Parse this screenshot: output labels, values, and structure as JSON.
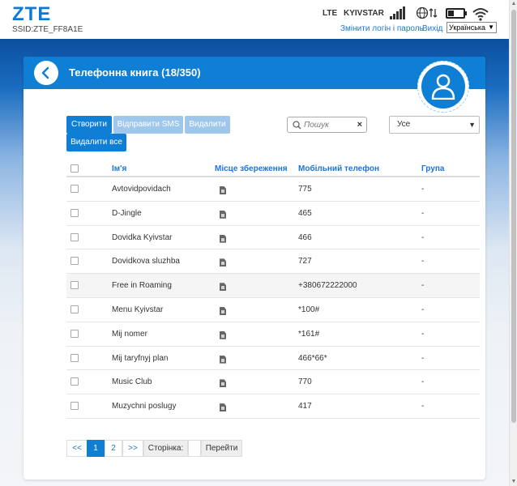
{
  "header": {
    "logo": "ZTE",
    "ssid": "SSID:ZTE_FF8A1E",
    "network_type": "LTE",
    "operator": "KYIVSTAR",
    "change_login_link": "Змінити логін і пароль",
    "logout_link": "Вихід",
    "language": "Українська"
  },
  "page": {
    "title": "Телефонна книга (18/350)"
  },
  "toolbar": {
    "create_label": "Створити",
    "send_sms_label": "Відправити SMS",
    "delete_label": "Видалити",
    "delete_all_label": "Видалити все",
    "search_placeholder": "Пошук",
    "group_filter": "Усе"
  },
  "table": {
    "headers": {
      "name": "Ім'я",
      "storage": "Місце збереження",
      "mobile": "Мобільний телефон",
      "group": "Група"
    },
    "rows": [
      {
        "name": "Avtovidpovidach",
        "phone": "775",
        "group": "-"
      },
      {
        "name": "D-Jingle",
        "phone": "465",
        "group": "-"
      },
      {
        "name": "Dovidka Kyivstar",
        "phone": "466",
        "group": "-"
      },
      {
        "name": "Dovidkova sluzhba",
        "phone": "727",
        "group": "-"
      },
      {
        "name": "Free in Roaming",
        "phone": "+380672222000",
        "group": "-"
      },
      {
        "name": "Menu Kyivstar",
        "phone": "*100#",
        "group": "-"
      },
      {
        "name": "Mij nomer",
        "phone": "*161#",
        "group": "-"
      },
      {
        "name": "Mij taryfnyj plan",
        "phone": "466*66*",
        "group": "-"
      },
      {
        "name": "Music Club",
        "phone": "770",
        "group": "-"
      },
      {
        "name": "Muzychni poslugy",
        "phone": "417",
        "group": "-"
      }
    ]
  },
  "pagination": {
    "prev_label": "<<",
    "page1": "1",
    "page2": "2",
    "next_label": ">>",
    "page_label": "Сторінка:",
    "go_label": "Перейти"
  },
  "colors": {
    "accent": "#0f7fd6",
    "disabled_button": "#9fc7ec"
  }
}
